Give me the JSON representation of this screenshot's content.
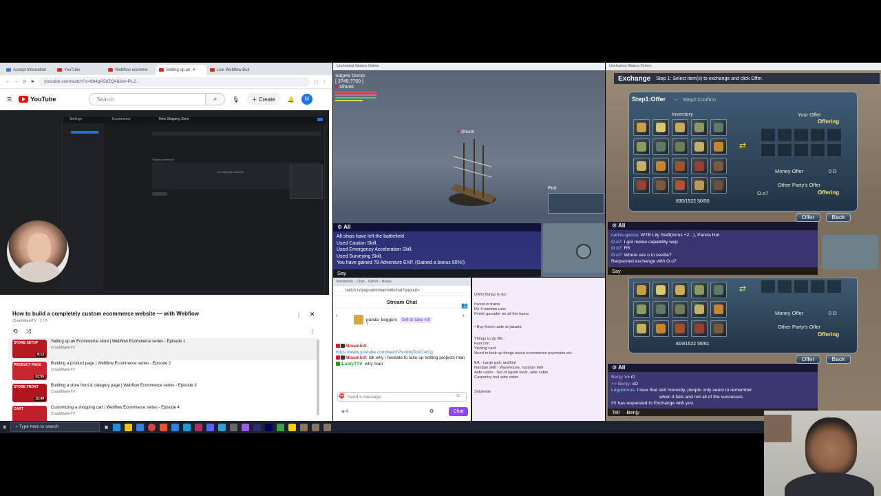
{
  "youtube": {
    "tabs": [
      {
        "label": "Accept Internation"
      },
      {
        "label": "YouTube"
      },
      {
        "label": "Webflow ecomme"
      },
      {
        "label": "Setting up an"
      },
      {
        "label": "Live Webflow Buil"
      }
    ],
    "url": "youtube.com/watch?v=6h4gA5dZQ4&list=PLJ...",
    "search_placeholder": "Search",
    "create_label": "Create",
    "avatar_letter": "M",
    "logo_text": "YouTube",
    "video_panel": {
      "settings_label": "Settings",
      "ecommerce_label": "Ecommerce",
      "zone_title": "New Shipping Zone",
      "shipping_methods_label": "Shipping methods",
      "no_methods_text": "No shipping methods"
    },
    "playlist": {
      "title": "How to build a completely custom ecommerce website — with Webflow",
      "channel": "CharliMarieTV · 1 / 6",
      "items": [
        {
          "thumb": "STORE SETUP",
          "duration": "8:13",
          "title": "Setting up an Ecommerce store | Webflow Ecommerce series - Episode 1",
          "channel": "CharliMarieTV"
        },
        {
          "thumb": "PRODUCT PAGE",
          "duration": "22:55",
          "title": "Building a product page | Webflow Ecommerce series - Episode 2",
          "channel": "CharliMarieTV"
        },
        {
          "thumb": "STORE FRONT",
          "duration": "15:49",
          "title": "Building a store front & category page | Webflow Ecommerce series - Episode 3",
          "channel": "CharliMarieTV"
        },
        {
          "thumb": "CART",
          "duration": "",
          "title": "Customizing a shopping cart | Webflow Ecommerce series - Episode 4",
          "channel": "CharliMarieTV"
        }
      ]
    }
  },
  "game_left": {
    "window_title": "Uncharted Waters Online",
    "location": "Sagres Docks",
    "coords": "[ 3?45,??60 ]",
    "player_name": "Ghunti",
    "ship_label": "Ghunti",
    "port_label": "Port",
    "chat_channel": "All",
    "chat_lines": [
      "All ships have left the battlefield",
      "Used Caution Skill.",
      "Used Emergency Acceleration Skill.",
      "Used Surveying Skill.",
      "You have gained 78 Adventure EXP. (Gained a bonus 50%!)"
    ],
    "say_label": "Say"
  },
  "game_right": {
    "window_title": "Uncharted Waters Online",
    "exchange_title": "Exchange",
    "step_text": "Step 1: Select item(s) to exchange and click Offer.",
    "step1_label": "Step1:Offer",
    "step2_label": "Step2:Confirm",
    "inventory_label": "Inventory",
    "your_offer_label": "Your Offer",
    "offering_label": "Offering",
    "money_offer_label": "Money Offer",
    "money_value": "0 D",
    "other_offer_label": "Other Party's Offer",
    "other_party_name": "O.o7",
    "weight_a": "830/1522",
    "slots_a": "50/50",
    "weight_b": "819/1522",
    "slots_b": "56/61",
    "offer_button": "Offer",
    "back_button": "Back",
    "chat_channel": "All",
    "chat_a": [
      {
        "name": "carlos-garcia",
        "text": ": WTB Lily Staff(Arms +2...), Panda Hat"
      },
      {
        "name": "O.o7",
        "text": ": I got melee capability wep"
      },
      {
        "name": "O.o7",
        "text": ": R5"
      },
      {
        "name": "O.o7",
        "text": ": Where are u in seville?"
      },
      {
        "name": "",
        "text": "Requested exchange with O.o7"
      }
    ],
    "say_label": "Say",
    "chat_b": [
      {
        "name": "Benjy",
        "text": ">> r0"
      },
      {
        "name": ">> Benjy",
        "text": ": xD"
      },
      {
        "name": "Lugubrious",
        "text": ": I love that skill honestly, people only seem to remember"
      },
      {
        "name": "",
        "text": "when it fails and not all of the successes"
      },
      {
        "name": "",
        "text": "!!!! has requested to Exchange with you."
      }
    ],
    "tell_label": "Tell",
    "tell_target": "Benjy"
  },
  "twitch": {
    "window_title": "Minamin0 - Chat - Twitch - Brave",
    "url": "twitch.tv/popout/minamin0/chat?popout=",
    "header": "Stream Chat",
    "pinned_user": "panda_boggers",
    "pinned_gift": "Gift to take #2!",
    "pinned_count": "1",
    "messages": [
      {
        "user": "Minamin0",
        "text": ":",
        "color": "#d2202b"
      },
      {
        "user": "",
        "text": "https://www.youtube.com/watch?v=bIkjToXCwCg",
        "color": "#3a6dd8"
      },
      {
        "user": "Minamin0",
        "text": ": idk why i hesitate to take up editing projects man",
        "color": "#d2202b"
      },
      {
        "user": "iLustyTTV",
        "text": ": why man",
        "color": "#1f9d2a"
      }
    ],
    "input_placeholder": "Send a message",
    "points": "0",
    "chat_button": "Chat"
  },
  "notes": {
    "heading": "UWO things to do:",
    "lines_a": [
      "Invest in trains",
      "Do 4 nanban runs",
      "Finish ganador on all the toons"
    ],
    "lines_b": [
      "• Buy Karen aide at jakarta"
    ],
    "heading2": "Things to do IRL:",
    "lines_c": [
      "Fast con",
      "Visiting card",
      "Need to look up things about ecommerce payments etc"
    ],
    "lines_d": [
      "EA - Large galt. andfoul",
      "Nanban skill - Warehouse, nanban skill",
      "Aide cabin - Set of repair tools, aide cabin",
      "Carpentry tool aide cabin"
    ],
    "footer": "Sylphette"
  },
  "taskbar": {
    "search_placeholder": "Type here to search"
  },
  "colors": {
    "accent_youtube": "#ff0000",
    "twitch_purple": "#9147ff",
    "offering_gold": "#f8e27a"
  }
}
